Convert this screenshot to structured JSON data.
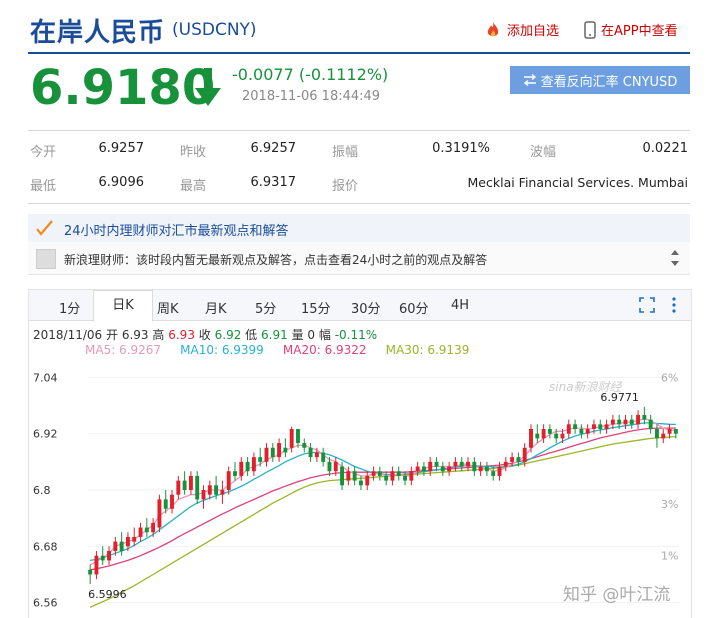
{
  "header": {
    "title": "在岸人民币",
    "code": "(USDCNY)",
    "add_fav_label": "添加自选",
    "app_label": "在APP中查看",
    "price": "6.9180",
    "change": "-0.0077 (-0.1112%)",
    "time": "2018-11-06 18:44:49",
    "reverse_label": "查看反向汇率 CNYUSD"
  },
  "stats": {
    "open_label": "今开",
    "open": "6.9257",
    "prev_label": "昨收",
    "prev": "6.9257",
    "amp_label": "振幅",
    "amp": "0.3191%",
    "wave_label": "波幅",
    "wave": "0.0221",
    "low_label": "最低",
    "low": "6.9096",
    "high_label": "最高",
    "high": "6.9317",
    "quote_label": "报价",
    "quote": "Mecklai Financial Services. Mumbai"
  },
  "experts": {
    "title": "24小时内理财师对汇市最新观点和解答",
    "message": "新浪理财师：该时段内暂无最新观点及解答，点击查看24小时之前的观点及解答"
  },
  "chart_tabs": [
    "1分",
    "日K",
    "周K",
    "月K",
    "5分",
    "15分",
    "30分",
    "60分",
    "4H"
  ],
  "active_tab": 1,
  "chart_info": {
    "date": "2018/11/06",
    "open_label": "开",
    "open": "6.93",
    "high_label": "高",
    "high": "6.93",
    "close_label": "收",
    "close": "6.92",
    "low_label": "低",
    "low": "6.91",
    "vol_label": "量",
    "vol": "0",
    "amp_label": "幅",
    "amp": "-0.11%",
    "ma5": "MA5: 6.9267",
    "ma10": "MA10: 6.9399",
    "ma20": "MA20: 6.9322",
    "ma30": "MA30: 6.9139"
  },
  "watermarks": {
    "sina": "sina新浪财经",
    "zhihu": "知乎 @叶江流"
  },
  "colors": {
    "up": "#e0202a",
    "down": "#17923b",
    "ma5": "#e899b4",
    "ma10": "#29b1cc",
    "ma20": "#e0407a",
    "ma30": "#9bb52a",
    "brand": "#1a4c9a"
  },
  "chart_data": {
    "type": "candlestick",
    "y_ticks": [
      "7.04",
      "6.92",
      "6.8",
      "6.68",
      "6.56"
    ],
    "y_right_ticks": [
      "6%",
      "3%",
      "1%"
    ],
    "ylim": [
      6.54,
      7.06
    ],
    "annotations": {
      "high": "6.9771",
      "low": "6.5996"
    },
    "candles": [
      [
        6.63,
        6.62,
        6.641,
        6.5996
      ],
      [
        6.62,
        6.66,
        6.67,
        6.61
      ],
      [
        6.66,
        6.65,
        6.68,
        6.64
      ],
      [
        6.65,
        6.67,
        6.68,
        6.64
      ],
      [
        6.67,
        6.69,
        6.7,
        6.66
      ],
      [
        6.69,
        6.67,
        6.71,
        6.66
      ],
      [
        6.68,
        6.7,
        6.71,
        6.67
      ],
      [
        6.69,
        6.7,
        6.72,
        6.68
      ],
      [
        6.7,
        6.72,
        6.73,
        6.69
      ],
      [
        6.72,
        6.71,
        6.74,
        6.7
      ],
      [
        6.71,
        6.73,
        6.74,
        6.7
      ],
      [
        6.72,
        6.78,
        6.79,
        6.71
      ],
      [
        6.78,
        6.76,
        6.8,
        6.75
      ],
      [
        6.76,
        6.79,
        6.8,
        6.75
      ],
      [
        6.79,
        6.82,
        6.83,
        6.78
      ],
      [
        6.82,
        6.8,
        6.84,
        6.79
      ],
      [
        6.8,
        6.83,
        6.84,
        6.79
      ],
      [
        6.83,
        6.78,
        6.84,
        6.77
      ],
      [
        6.78,
        6.8,
        6.81,
        6.76
      ],
      [
        6.79,
        6.81,
        6.82,
        6.78
      ],
      [
        6.81,
        6.79,
        6.83,
        6.78
      ],
      [
        6.79,
        6.8,
        6.82,
        6.77
      ],
      [
        6.8,
        6.84,
        6.85,
        6.79
      ],
      [
        6.84,
        6.83,
        6.86,
        6.82
      ],
      [
        6.83,
        6.86,
        6.87,
        6.82
      ],
      [
        6.86,
        6.84,
        6.87,
        6.83
      ],
      [
        6.84,
        6.87,
        6.88,
        6.83
      ],
      [
        6.87,
        6.86,
        6.89,
        6.85
      ],
      [
        6.86,
        6.89,
        6.9,
        6.85
      ],
      [
        6.89,
        6.87,
        6.9,
        6.86
      ],
      [
        6.87,
        6.9,
        6.91,
        6.86
      ],
      [
        6.89,
        6.88,
        6.91,
        6.87
      ],
      [
        6.89,
        6.93,
        6.935,
        6.88
      ],
      [
        6.93,
        6.9,
        6.93,
        6.89
      ],
      [
        6.9,
        6.89,
        6.91,
        6.88
      ],
      [
        6.89,
        6.87,
        6.9,
        6.86
      ],
      [
        6.87,
        6.88,
        6.89,
        6.86
      ],
      [
        6.88,
        6.86,
        6.89,
        6.85
      ],
      [
        6.86,
        6.84,
        6.87,
        6.83
      ],
      [
        6.84,
        6.86,
        6.87,
        6.83
      ],
      [
        6.85,
        6.81,
        6.86,
        6.8
      ],
      [
        6.82,
        6.84,
        6.85,
        6.81
      ],
      [
        6.84,
        6.82,
        6.85,
        6.81
      ],
      [
        6.82,
        6.81,
        6.83,
        6.8
      ],
      [
        6.81,
        6.83,
        6.84,
        6.8
      ],
      [
        6.83,
        6.84,
        6.85,
        6.82
      ],
      [
        6.84,
        6.83,
        6.85,
        6.82
      ],
      [
        6.83,
        6.82,
        6.84,
        6.81
      ],
      [
        6.82,
        6.84,
        6.85,
        6.81
      ],
      [
        6.84,
        6.83,
        6.85,
        6.82
      ],
      [
        6.83,
        6.82,
        6.84,
        6.81
      ],
      [
        6.82,
        6.84,
        6.85,
        6.81
      ],
      [
        6.84,
        6.85,
        6.86,
        6.83
      ],
      [
        6.85,
        6.84,
        6.86,
        6.83
      ],
      [
        6.84,
        6.86,
        6.87,
        6.83
      ],
      [
        6.86,
        6.85,
        6.87,
        6.84
      ],
      [
        6.85,
        6.84,
        6.86,
        6.83
      ],
      [
        6.84,
        6.85,
        6.86,
        6.83
      ],
      [
        6.85,
        6.86,
        6.87,
        6.84
      ],
      [
        6.86,
        6.85,
        6.87,
        6.84
      ],
      [
        6.85,
        6.86,
        6.87,
        6.84
      ],
      [
        6.86,
        6.84,
        6.87,
        6.83
      ],
      [
        6.84,
        6.85,
        6.86,
        6.83
      ],
      [
        6.85,
        6.84,
        6.86,
        6.83
      ],
      [
        6.84,
        6.83,
        6.85,
        6.82
      ],
      [
        6.83,
        6.85,
        6.86,
        6.82
      ],
      [
        6.85,
        6.86,
        6.87,
        6.84
      ],
      [
        6.86,
        6.87,
        6.88,
        6.85
      ],
      [
        6.87,
        6.86,
        6.88,
        6.85
      ],
      [
        6.86,
        6.89,
        6.9,
        6.85
      ],
      [
        6.89,
        6.93,
        6.94,
        6.88
      ],
      [
        6.92,
        6.91,
        6.94,
        6.9
      ],
      [
        6.91,
        6.93,
        6.94,
        6.9
      ],
      [
        6.93,
        6.92,
        6.94,
        6.91
      ],
      [
        6.92,
        6.91,
        6.93,
        6.9
      ],
      [
        6.91,
        6.92,
        6.93,
        6.9
      ],
      [
        6.92,
        6.94,
        6.95,
        6.91
      ],
      [
        6.94,
        6.93,
        6.95,
        6.92
      ],
      [
        6.93,
        6.92,
        6.94,
        6.91
      ],
      [
        6.92,
        6.93,
        6.94,
        6.91
      ],
      [
        6.93,
        6.94,
        6.95,
        6.92
      ],
      [
        6.94,
        6.93,
        6.95,
        6.92
      ],
      [
        6.93,
        6.94,
        6.95,
        6.92
      ],
      [
        6.94,
        6.95,
        6.96,
        6.93
      ],
      [
        6.95,
        6.94,
        6.96,
        6.93
      ],
      [
        6.94,
        6.95,
        6.96,
        6.93
      ],
      [
        6.95,
        6.94,
        6.96,
        6.93
      ],
      [
        6.94,
        6.96,
        6.97,
        6.93
      ],
      [
        6.96,
        6.95,
        6.9771,
        6.94
      ],
      [
        6.95,
        6.93,
        6.96,
        6.92
      ],
      [
        6.93,
        6.91,
        6.94,
        6.89
      ],
      [
        6.91,
        6.92,
        6.93,
        6.9
      ],
      [
        6.92,
        6.93,
        6.94,
        6.91
      ],
      [
        6.93,
        6.92,
        6.93,
        6.91
      ]
    ],
    "ma5": [
      6.64,
      6.648,
      6.655,
      6.665,
      6.68,
      6.685,
      6.69,
      6.695,
      6.705,
      6.715,
      6.725,
      6.745,
      6.755,
      6.765,
      6.78,
      6.785,
      6.79,
      6.79,
      6.795,
      6.8,
      6.8,
      6.8,
      6.81,
      6.82,
      6.83,
      6.845,
      6.85,
      6.855,
      6.865,
      6.87,
      6.875,
      6.885,
      6.89,
      6.895,
      6.895,
      6.89,
      6.885,
      6.875,
      6.865,
      6.86,
      6.85,
      6.84,
      6.835,
      6.83,
      6.83,
      6.835,
      6.835,
      6.83,
      6.83,
      6.835,
      6.83,
      6.83,
      6.84,
      6.845,
      6.85,
      6.85,
      6.85,
      6.85,
      6.85,
      6.855,
      6.855,
      6.85,
      6.848,
      6.846,
      6.84,
      6.842,
      6.848,
      6.855,
      6.862,
      6.872,
      6.888,
      6.9,
      6.91,
      6.918,
      6.925,
      6.925,
      6.93,
      6.932,
      6.932,
      6.93,
      6.932,
      6.935,
      6.937,
      6.94,
      6.942,
      6.944,
      6.945,
      6.948,
      6.952,
      6.948,
      6.94,
      6.932,
      6.928,
      6.927
    ],
    "ma10": [
      6.65,
      6.652,
      6.655,
      6.66,
      6.665,
      6.67,
      6.675,
      6.682,
      6.69,
      6.697,
      6.705,
      6.715,
      6.725,
      6.735,
      6.745,
      6.755,
      6.765,
      6.772,
      6.778,
      6.783,
      6.788,
      6.792,
      6.796,
      6.802,
      6.808,
      6.815,
      6.823,
      6.83,
      6.838,
      6.845,
      6.852,
      6.86,
      6.866,
      6.872,
      6.877,
      6.88,
      6.88,
      6.878,
      6.875,
      6.87,
      6.864,
      6.857,
      6.85,
      6.845,
      6.84,
      6.837,
      6.835,
      6.833,
      6.832,
      6.833,
      6.834,
      6.835,
      6.837,
      6.839,
      6.841,
      6.843,
      6.845,
      6.847,
      6.849,
      6.851,
      6.852,
      6.852,
      6.851,
      6.85,
      6.849,
      6.849,
      6.85,
      6.852,
      6.855,
      6.86,
      6.867,
      6.875,
      6.882,
      6.89,
      6.897,
      6.904,
      6.91,
      6.915,
      6.919,
      6.922,
      6.925,
      6.928,
      6.93,
      6.933,
      6.935,
      6.937,
      6.939,
      6.941,
      6.943,
      6.943,
      6.942,
      6.941,
      6.94,
      6.9399
    ],
    "ma20": [
      6.63,
      6.632,
      6.635,
      6.638,
      6.642,
      6.646,
      6.65,
      6.655,
      6.66,
      6.666,
      6.672,
      6.678,
      6.685,
      6.692,
      6.7,
      6.707,
      6.714,
      6.721,
      6.728,
      6.735,
      6.742,
      6.749,
      6.755,
      6.762,
      6.768,
      6.774,
      6.78,
      6.786,
      6.792,
      6.798,
      6.803,
      6.808,
      6.813,
      6.818,
      6.822,
      6.826,
      6.829,
      6.832,
      6.834,
      6.836,
      6.837,
      6.838,
      6.838,
      6.838,
      6.838,
      6.838,
      6.838,
      6.838,
      6.838,
      6.838,
      6.838,
      6.839,
      6.84,
      6.841,
      6.842,
      6.843,
      6.844,
      6.845,
      6.846,
      6.847,
      6.848,
      6.849,
      6.85,
      6.851,
      6.852,
      6.853,
      6.855,
      6.857,
      6.86,
      6.863,
      6.867,
      6.871,
      6.875,
      6.879,
      6.883,
      6.887,
      6.891,
      6.895,
      6.899,
      6.903,
      6.907,
      6.911,
      6.914,
      6.917,
      6.92,
      6.923,
      6.926,
      6.928,
      6.93,
      6.931,
      6.932,
      6.932,
      6.932,
      6.9322
    ],
    "ma30": [
      6.55,
      6.556,
      6.562,
      6.568,
      6.575,
      6.582,
      6.589,
      6.596,
      6.604,
      6.612,
      6.62,
      6.628,
      6.636,
      6.644,
      6.652,
      6.66,
      6.668,
      6.676,
      6.684,
      6.692,
      6.7,
      6.708,
      6.716,
      6.724,
      6.732,
      6.74,
      6.748,
      6.756,
      6.764,
      6.772,
      6.779,
      6.786,
      6.793,
      6.8,
      6.806,
      6.811,
      6.815,
      6.818,
      6.82,
      6.821,
      6.822,
      6.823,
      6.824,
      6.825,
      6.826,
      6.827,
      6.828,
      6.829,
      6.83,
      6.831,
      6.832,
      6.833,
      6.834,
      6.835,
      6.836,
      6.837,
      6.838,
      6.839,
      6.84,
      6.841,
      6.842,
      6.843,
      6.844,
      6.845,
      6.846,
      6.847,
      6.849,
      6.851,
      6.853,
      6.856,
      6.859,
      6.862,
      6.865,
      6.868,
      6.871,
      6.874,
      6.877,
      6.88,
      6.883,
      6.886,
      6.889,
      6.892,
      6.895,
      6.898,
      6.9,
      6.902,
      6.904,
      6.906,
      6.908,
      6.91,
      6.911,
      6.912,
      6.913,
      6.9139
    ]
  }
}
